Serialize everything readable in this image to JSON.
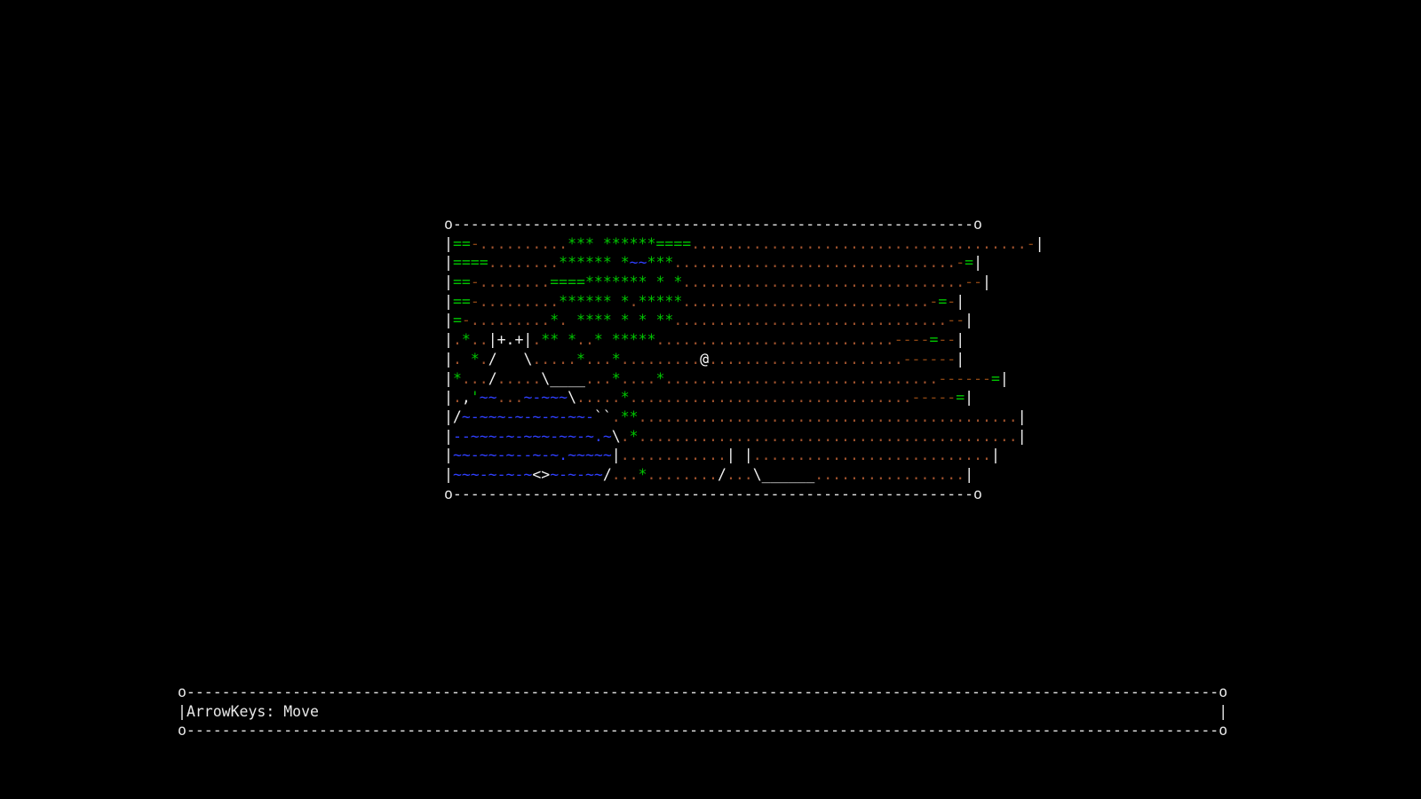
{
  "map": {
    "border_top": "o-----------------------------------------------------------o",
    "border_bottom": "o-----------------------------------------------------------o",
    "rows": [
      [
        [
          "w",
          "|"
        ],
        [
          "g",
          "=="
        ],
        [
          "o",
          "-"
        ],
        [
          "d",
          ".........."
        ],
        [
          "g",
          "***"
        ],
        [
          "d",
          " "
        ],
        [
          "g",
          "******===="
        ],
        [
          "d",
          "......................................"
        ],
        [
          "o",
          "-"
        ],
        [
          "w",
          "|"
        ]
      ],
      [
        [
          "w",
          "|"
        ],
        [
          "g",
          "===="
        ],
        [
          "d",
          "........"
        ],
        [
          "g",
          "******"
        ],
        [
          "d",
          " "
        ],
        [
          "g",
          "*"
        ],
        [
          "b",
          "~~"
        ],
        [
          "g",
          "***"
        ],
        [
          "d",
          "................................"
        ],
        [
          "o",
          "-"
        ],
        [
          "g",
          "="
        ],
        [
          "w",
          "|"
        ]
      ],
      [
        [
          "w",
          "|"
        ],
        [
          "g",
          "=="
        ],
        [
          "o",
          "-"
        ],
        [
          "d",
          "........"
        ],
        [
          "g",
          "====*******"
        ],
        [
          "d",
          " "
        ],
        [
          "g",
          "*"
        ],
        [
          "d",
          " "
        ],
        [
          "g",
          "*"
        ],
        [
          "d",
          "................................"
        ],
        [
          "o",
          "--"
        ],
        [
          "w",
          "|"
        ]
      ],
      [
        [
          "w",
          "|"
        ],
        [
          "g",
          "=="
        ],
        [
          "o",
          "-"
        ],
        [
          "d",
          "........."
        ],
        [
          "g",
          "******"
        ],
        [
          "d",
          " "
        ],
        [
          "g",
          "*"
        ],
        [
          "d",
          "."
        ],
        [
          "g",
          "*****"
        ],
        [
          "d",
          "............................"
        ],
        [
          "o",
          "-"
        ],
        [
          "g",
          "="
        ],
        [
          "o",
          "-"
        ],
        [
          "w",
          "|"
        ]
      ],
      [
        [
          "w",
          "|"
        ],
        [
          "g",
          "="
        ],
        [
          "o",
          "-"
        ],
        [
          "d",
          "........."
        ],
        [
          "g",
          "*"
        ],
        [
          "d",
          "."
        ],
        [
          "d",
          " "
        ],
        [
          "g",
          "****"
        ],
        [
          "d",
          " "
        ],
        [
          "g",
          "*"
        ],
        [
          "d",
          " "
        ],
        [
          "g",
          "*"
        ],
        [
          "d",
          " "
        ],
        [
          "g",
          "**"
        ],
        [
          "d",
          "..............................."
        ],
        [
          "o",
          "--"
        ],
        [
          "w",
          "|"
        ]
      ],
      [
        [
          "w",
          "|"
        ],
        [
          "d",
          "."
        ],
        [
          "g",
          "*"
        ],
        [
          "d",
          ".."
        ],
        [
          "w",
          "|+.+|"
        ],
        [
          "d",
          "."
        ],
        [
          "g",
          "**"
        ],
        [
          "d",
          " "
        ],
        [
          "g",
          "*"
        ],
        [
          "d",
          ".."
        ],
        [
          "g",
          "*"
        ],
        [
          "d",
          " "
        ],
        [
          "g",
          "*****"
        ],
        [
          "d",
          "..........................."
        ],
        [
          "o",
          "----"
        ],
        [
          "g",
          "="
        ],
        [
          "o",
          "--"
        ],
        [
          "w",
          "|"
        ]
      ],
      [
        [
          "w",
          "|"
        ],
        [
          "d",
          ". "
        ],
        [
          "g",
          "*"
        ],
        [
          "d",
          "."
        ],
        [
          "w",
          "/"
        ],
        [
          "d",
          "   "
        ],
        [
          "w",
          "\\"
        ],
        [
          "d",
          "....."
        ],
        [
          "g",
          "*"
        ],
        [
          "d",
          "..."
        ],
        [
          "g",
          "*"
        ],
        [
          "d",
          "........."
        ],
        [
          "p",
          "@"
        ],
        [
          "d",
          "......................"
        ],
        [
          "o",
          "------"
        ],
        [
          "w",
          "|"
        ]
      ],
      [
        [
          "w",
          "|"
        ],
        [
          "g",
          "*"
        ],
        [
          "d",
          "..."
        ],
        [
          "w",
          "/"
        ],
        [
          "d",
          "....."
        ],
        [
          "w",
          "\\____"
        ],
        [
          "d",
          "..."
        ],
        [
          "g",
          "*"
        ],
        [
          "d",
          "...."
        ],
        [
          "g",
          "*"
        ],
        [
          "d",
          "..............................."
        ],
        [
          "o",
          "------"
        ],
        [
          "g",
          "="
        ],
        [
          "w",
          "|"
        ]
      ],
      [
        [
          "w",
          "|"
        ],
        [
          "d",
          "."
        ],
        [
          "w",
          ","
        ],
        [
          "g",
          "'"
        ],
        [
          "b",
          "~~"
        ],
        [
          "d",
          "..."
        ],
        [
          "b",
          "~-~~~"
        ],
        [
          "w",
          "\\"
        ],
        [
          "d",
          "....."
        ],
        [
          "g",
          "*"
        ],
        [
          "d",
          "................................"
        ],
        [
          "o",
          "-----"
        ],
        [
          "g",
          "="
        ],
        [
          "w",
          "|"
        ]
      ],
      [
        [
          "w",
          "|/"
        ],
        [
          "b",
          "~-~~~-~-~-~-~~-"
        ],
        [
          "w",
          "``"
        ],
        [
          "d",
          "."
        ],
        [
          "g",
          "**"
        ],
        [
          "d",
          "..........................................."
        ],
        [
          "w",
          "|"
        ]
      ],
      [
        [
          "w",
          "|"
        ],
        [
          "b",
          "--~~~-~-~~~-~~-~."
        ],
        [
          "b",
          "~"
        ],
        [
          "w",
          "\\"
        ],
        [
          "d",
          "."
        ],
        [
          "g",
          "*"
        ],
        [
          "d",
          "..........................................."
        ],
        [
          "w",
          "|"
        ]
      ],
      [
        [
          "w",
          "|"
        ],
        [
          "b",
          "~~-~~-~--~-~.~~~~~"
        ],
        [
          "w",
          "|"
        ],
        [
          "d",
          "............"
        ],
        [
          "w",
          "| |"
        ],
        [
          "d",
          "..........................."
        ],
        [
          "w",
          "|"
        ]
      ],
      [
        [
          "w",
          "|"
        ],
        [
          "b",
          "~~~-~-~-~"
        ],
        [
          "w",
          "<>"
        ],
        [
          "b",
          "~-~-~~"
        ],
        [
          "w",
          "/"
        ],
        [
          "d",
          "..."
        ],
        [
          "g",
          "*"
        ],
        [
          "d",
          "........"
        ],
        [
          "w",
          "/"
        ],
        [
          "d",
          "..."
        ],
        [
          "w",
          "\\______"
        ],
        [
          "d",
          "................."
        ],
        [
          "w",
          "|"
        ]
      ]
    ]
  },
  "help": {
    "border_top": "o---------------------------------------------------------------------------------------------------------------------o",
    "text": "ArrowKeys: Move",
    "border_bottom": "o---------------------------------------------------------------------------------------------------------------------o"
  },
  "colors": {
    "background": "#000000",
    "tree": "#00c800",
    "dirt": "#a0522d",
    "water": "#2f3fff",
    "wall": "#f0f0f0"
  }
}
